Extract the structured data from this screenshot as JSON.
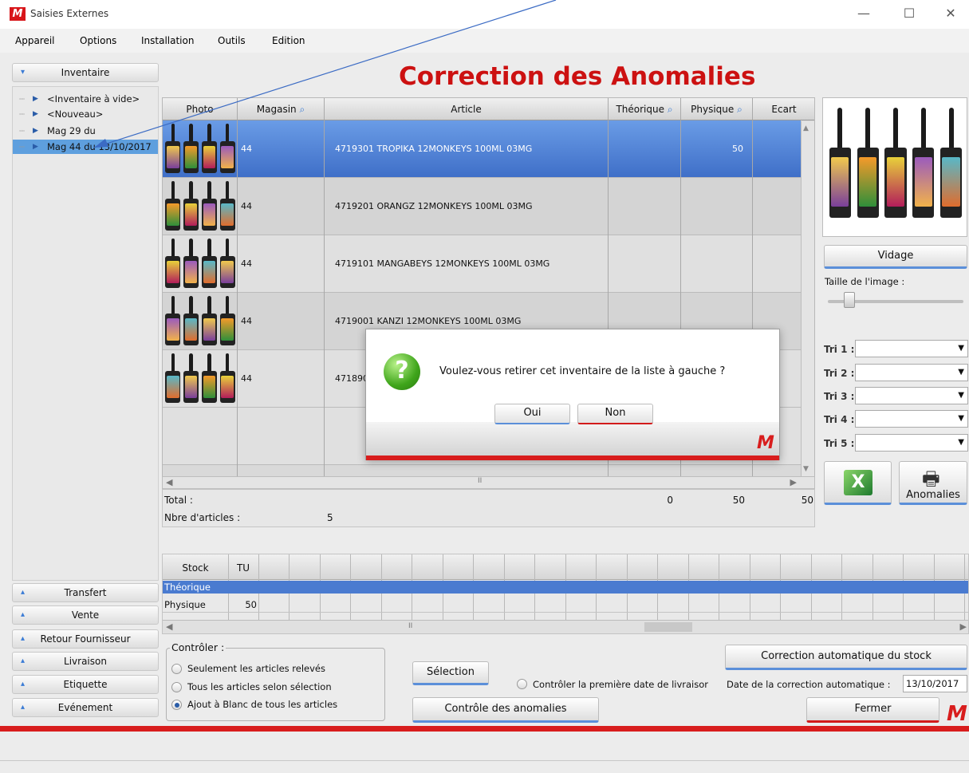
{
  "window": {
    "title": "Saisies Externes",
    "logo_text": "M",
    "minimize": "—",
    "maximize": "☐",
    "close": "✕"
  },
  "menu": [
    "Appareil",
    "Options",
    "Installation",
    "Outils",
    "Edition"
  ],
  "left_nav": {
    "top_button": "Inventaire",
    "tree": [
      "<Inventaire à vide>",
      "<Nouveau>",
      "Mag 29 du",
      "Mag 44 du 13/10/2017"
    ],
    "bottom_buttons": [
      "Transfert",
      "Vente",
      "Retour Fournisseur",
      "Livraison",
      "Etiquette",
      "Evénement"
    ]
  },
  "page_title": "Correction des Anomalies",
  "grid": {
    "headers": [
      "Photo",
      "Magasin",
      "Article",
      "Théorique",
      "Physique",
      "Ecart"
    ],
    "rows": [
      {
        "magasin": "44",
        "article": "4719301 TROPIKA 12MONKEYS 100ML 03MG",
        "theorique": "",
        "physique": "50"
      },
      {
        "magasin": "44",
        "article": "4719201 ORANGZ 12MONKEYS 100ML 03MG",
        "theorique": "",
        "physique": ""
      },
      {
        "magasin": "44",
        "article": "4719101 MANGABEYS 12MONKEYS 100ML 03MG",
        "theorique": "",
        "physique": ""
      },
      {
        "magasin": "44",
        "article": "4719001 KANZI 12MONKEYS 100ML 03MG",
        "theorique": "",
        "physique": ""
      },
      {
        "magasin": "44",
        "article": "4718901",
        "theorique": "",
        "physique": ""
      }
    ],
    "scroll_mark": "II"
  },
  "totals": {
    "total_label": "Total :",
    "count_label": "Nbre d'articles :",
    "count": "5",
    "theorique": "0",
    "physique": "50",
    "ecart": "50"
  },
  "right_panel": {
    "vidage": "Vidage",
    "image_size_label": "Taille de l'image :",
    "tri_labels": [
      "Tri 1 :",
      "Tri 2 :",
      "Tri 3 :",
      "Tri 4 :",
      "Tri 5 :"
    ],
    "anomalies": "Anomalies"
  },
  "stock": {
    "headers": [
      "Stock",
      "TU"
    ],
    "rows": [
      {
        "label": "Théorique",
        "value": ""
      },
      {
        "label": "Physique",
        "value": "50"
      }
    ]
  },
  "controls": {
    "group_label": "Contrôler :",
    "options": [
      "Seulement les articles relevés",
      "Tous les articles selon sélection",
      "Ajout à Blanc de tous les articles"
    ],
    "selection": "Sélection",
    "controle": "Contrôle des anomalies",
    "premiere_date": "Contrôler la première date de livraisor",
    "correction_auto": "Correction automatique du stock",
    "date_label": "Date de la correction automatique :",
    "date_value": "13/10/2017",
    "fermer": "Fermer"
  },
  "dialog": {
    "message": "Voulez-vous retirer cet inventaire de la liste à gauche ?",
    "yes": "Oui",
    "no": "Non",
    "icon_glyph": "?"
  },
  "colors": {
    "brand_red": "#cc1111",
    "selection_blue": "#4a7bd0",
    "bar_red": "#d81d1d"
  }
}
